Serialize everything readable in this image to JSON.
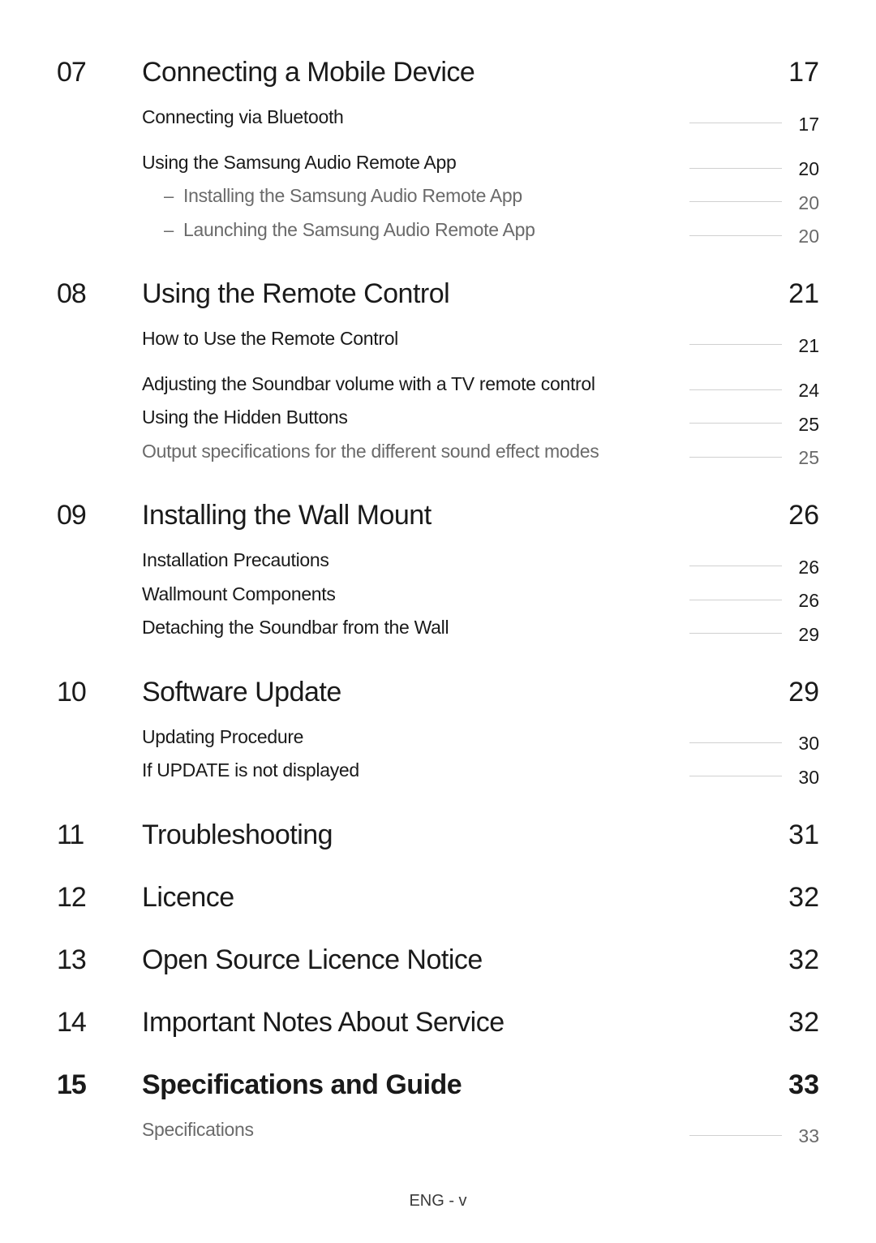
{
  "footer": "ENG - v",
  "sections": [
    {
      "num": "07",
      "title": "Connecting a Mobile Device",
      "page": "17",
      "bold": false,
      "groups": [
        [
          {
            "title": "Connecting via Bluetooth",
            "page": "17",
            "muted": false,
            "sub": false
          }
        ],
        [
          {
            "title": "Using the Samsung Audio Remote App",
            "page": "20",
            "muted": false,
            "sub": false
          },
          {
            "title": "Installing the Samsung Audio Remote App",
            "page": "20",
            "muted": true,
            "sub": true
          },
          {
            "title": "Launching the Samsung Audio Remote App",
            "page": "20",
            "muted": true,
            "sub": true
          }
        ]
      ]
    },
    {
      "num": "08",
      "title": "Using the Remote Control",
      "page": "21",
      "bold": false,
      "groups": [
        [
          {
            "title": "How to Use the Remote Control",
            "page": "21",
            "muted": false,
            "sub": false
          }
        ],
        [
          {
            "title": "Adjusting the Soundbar volume with a TV remote control",
            "page": "24",
            "muted": false,
            "sub": false
          },
          {
            "title": "Using the Hidden Buttons",
            "page": "25",
            "muted": false,
            "sub": false
          },
          {
            "title": "Output specifications for the different sound effect modes",
            "page": "25",
            "muted": true,
            "sub": false
          }
        ]
      ]
    },
    {
      "num": "09",
      "title": "Installing the Wall Mount",
      "page": "26",
      "bold": false,
      "groups": [
        [
          {
            "title": "Installation Precautions",
            "page": "26",
            "muted": false,
            "sub": false
          },
          {
            "title": "Wallmount Components",
            "page": "26",
            "muted": false,
            "sub": false
          },
          {
            "title": "Detaching the Soundbar from the Wall",
            "page": "29",
            "muted": false,
            "sub": false
          }
        ]
      ]
    },
    {
      "num": "10",
      "title": "Software Update",
      "page": "29",
      "bold": false,
      "groups": [
        [
          {
            "title": "Updating Procedure",
            "page": "30",
            "muted": false,
            "sub": false
          },
          {
            "title": "If UPDATE is not displayed",
            "page": "30",
            "muted": false,
            "sub": false
          }
        ]
      ]
    },
    {
      "num": "11",
      "title": "Troubleshooting",
      "page": "31",
      "bold": false,
      "groups": []
    },
    {
      "num": "12",
      "title": "Licence",
      "page": "32",
      "bold": false,
      "groups": []
    },
    {
      "num": "13",
      "title": "Open Source Licence Notice",
      "page": "32",
      "bold": false,
      "groups": []
    },
    {
      "num": "14",
      "title": "Important Notes About Service",
      "page": "32",
      "bold": false,
      "groups": []
    },
    {
      "num": "15",
      "title": "Specifications and Guide",
      "page": "33",
      "bold": true,
      "groups": [
        [
          {
            "title": "Specifications",
            "page": "33",
            "muted": true,
            "sub": false
          }
        ]
      ]
    }
  ]
}
